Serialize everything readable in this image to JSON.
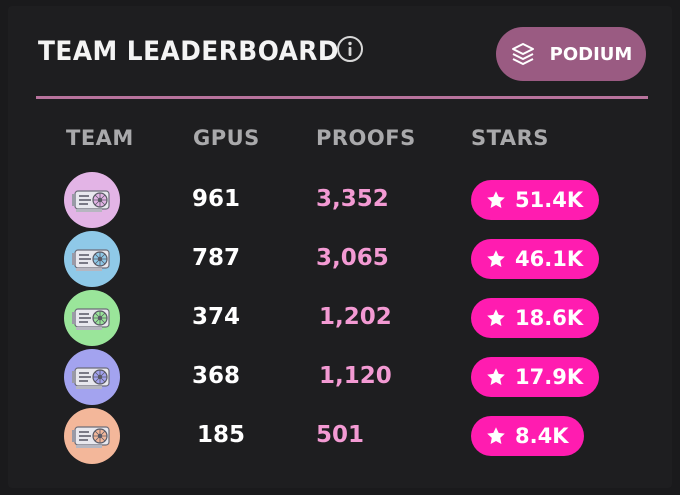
{
  "header": {
    "title": "TEAM LEADERBOARD",
    "podium_label": "PODIUM"
  },
  "columns": {
    "team": "TEAM",
    "gpus": "GPUS",
    "proofs": "PROOFS",
    "stars": "STARS"
  },
  "rows": [
    {
      "avatar_color": "#e3b4e6",
      "gpus": "961",
      "proofs": "3,352",
      "stars": "51.4K"
    },
    {
      "avatar_color": "#8fc9e8",
      "gpus": "787",
      "proofs": "3,065",
      "stars": "46.1K"
    },
    {
      "avatar_color": "#9ae59a",
      "gpus": "374",
      "proofs": "1,202",
      "stars": "18.6K"
    },
    {
      "avatar_color": "#a3a3ef",
      "gpus": "368",
      "proofs": "1,120",
      "stars": "17.9K"
    },
    {
      "avatar_color": "#f3b79a",
      "gpus": "185",
      "proofs": "501",
      "stars": "8.4K"
    }
  ],
  "colors": {
    "accent_pink": "#ff1cb0",
    "proofs_text": "#f39ad3",
    "podium_button": "#9a5b82",
    "divider": "#b8739d"
  },
  "icons": {
    "info": "info-icon",
    "podium": "layers-icon",
    "star": "star-icon",
    "avatar": "gpu-card-icon"
  }
}
